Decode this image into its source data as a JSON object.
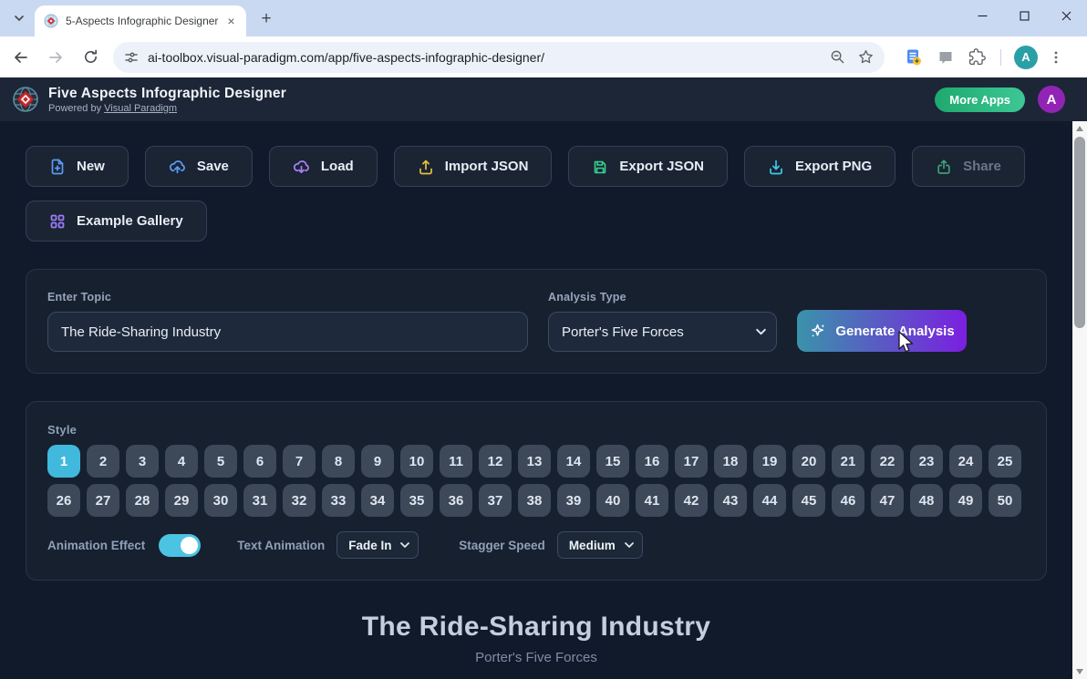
{
  "browser": {
    "tab_title": "5-Aspects Infographic Designer",
    "url": "ai-toolbox.visual-paradigm.com/app/five-aspects-infographic-designer/",
    "profile_letter": "A",
    "icons": [
      "tab-search-chevron-icon",
      "favicon",
      "close-icon",
      "new-tab-icon",
      "minimize-icon",
      "maximize-icon",
      "back-arrow-icon",
      "forward-arrow-icon",
      "reload-icon",
      "tune-icon",
      "zoom-out-icon",
      "bookmark-star-icon",
      "translate-doc-icon",
      "chat-icon",
      "extensions-puzzle-icon",
      "kebab-menu-icon"
    ]
  },
  "header": {
    "title": "Five Aspects Infographic Designer",
    "powered_prefix": "Powered by",
    "powered_link": "Visual Paradigm",
    "more_apps_label": "More Apps",
    "avatar_letter": "A",
    "logo": "visual-paradigm-logo"
  },
  "toolbar": {
    "buttons": [
      {
        "name": "new",
        "label": "New",
        "icon": "file-plus-icon",
        "icon_color": "#5b9bf0",
        "disabled": false
      },
      {
        "name": "save",
        "label": "Save",
        "icon": "cloud-upload-icon",
        "icon_color": "#5b9bf0",
        "disabled": false
      },
      {
        "name": "load",
        "label": "Load",
        "icon": "cloud-download-icon",
        "icon_color": "#a97ef5",
        "disabled": false
      },
      {
        "name": "import-json",
        "label": "Import JSON",
        "icon": "upload-icon",
        "icon_color": "#e6c13a",
        "disabled": false
      },
      {
        "name": "export-json",
        "label": "Export JSON",
        "icon": "save-disk-icon",
        "icon_color": "#37d08d",
        "disabled": false
      },
      {
        "name": "export-png",
        "label": "Export PNG",
        "icon": "download-icon",
        "icon_color": "#3fc9ea",
        "disabled": false
      },
      {
        "name": "share",
        "label": "Share",
        "icon": "share-icon",
        "icon_color": "#3f9e78",
        "disabled": true
      }
    ],
    "gallery_label": "Example Gallery",
    "gallery_icon": "grid-icon",
    "gallery_icon_color": "#9b7bf7"
  },
  "form": {
    "topic_label": "Enter Topic",
    "topic_value": "The Ride-Sharing Industry",
    "analysis_label": "Analysis Type",
    "analysis_value": "Porter's Five Forces",
    "generate_label": "Generate Analysis",
    "generate_icon": "sparkles-icon"
  },
  "style_section": {
    "label": "Style",
    "count": 50,
    "selected": 1,
    "animation_effect_label": "Animation Effect",
    "animation_on": true,
    "text_animation_label": "Text Animation",
    "text_animation_value": "Fade In",
    "stagger_label": "Stagger Speed",
    "stagger_value": "Medium"
  },
  "preview": {
    "title": "The Ride-Sharing Industry",
    "subtitle": "Porter's Five Forces"
  },
  "colors": {
    "page_bg": "#101a2b",
    "header_bg": "#1c2636",
    "card_bg": "#16202f",
    "accent_cyan": "#41b9dd",
    "toggle_cyan": "#4cc3e2",
    "generate_gradient_start": "#3a93ab",
    "generate_gradient_end": "#7b1fe0",
    "more_apps_green_start": "#1fa96f",
    "more_apps_green_end": "#3cc795",
    "header_avatar_purple": "#9224b5",
    "browser_avatar_teal": "#2aa0a6"
  }
}
